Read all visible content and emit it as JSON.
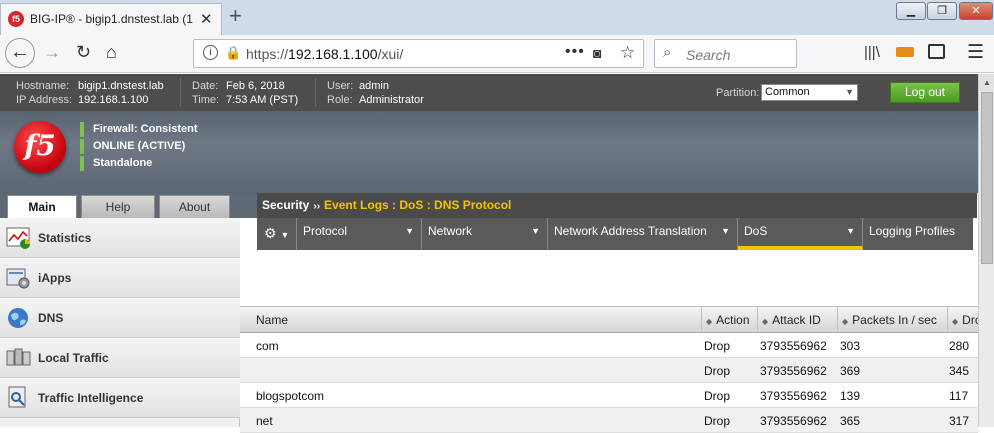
{
  "browser": {
    "tab_title": "BIG-IP® - bigip1.dnstest.lab (1",
    "tab_favicon": "f5",
    "url_prefix": "https://",
    "url_host": "192.168.1.100",
    "url_path": "/xui/",
    "search_placeholder": "Search",
    "window_controls": [
      "minimize",
      "restore",
      "close"
    ]
  },
  "header": {
    "hostname_label": "Hostname:",
    "hostname": "bigip1.dnstest.lab",
    "ip_label": "IP Address:",
    "ip": "192.168.1.100",
    "date_label": "Date:",
    "date": "Feb 6, 2018",
    "time_label": "Time:",
    "time": "7:53 AM (PST)",
    "user_label": "User:",
    "user": "admin",
    "role_label": "Role:",
    "role": "Administrator",
    "partition_label": "Partition:",
    "partition": "Common",
    "logout": "Log out"
  },
  "banner": {
    "logo": "f5",
    "status": [
      "Firewall: Consistent",
      "ONLINE (ACTIVE)",
      "Standalone"
    ],
    "status_color": "#7cc24a"
  },
  "main_tabs": [
    "Main",
    "Help",
    "About"
  ],
  "nav": [
    "Statistics",
    "iApps",
    "DNS",
    "Local Traffic",
    "Traffic Intelligence"
  ],
  "breadcrumb": {
    "section": "Security",
    "sep": "››",
    "path": "Event Logs : DoS : DNS Protocol"
  },
  "menu": {
    "gear": "⚙",
    "items": [
      "Protocol",
      "Network",
      "Network Address Translation",
      "DoS",
      "Logging Profiles"
    ],
    "active": "DoS"
  },
  "table": {
    "headers": [
      "Name",
      "Action",
      "Attack ID",
      "Packets In / sec",
      "Dro"
    ],
    "rows": [
      [
        "com",
        "Drop",
        "3793556962",
        "303",
        "280"
      ],
      [
        "",
        "Drop",
        "3793556962",
        "369",
        "345"
      ],
      [
        "blogspotcom",
        "Drop",
        "3793556962",
        "139",
        "117"
      ],
      [
        "net",
        "Drop",
        "3793556962",
        "365",
        "317"
      ]
    ]
  }
}
